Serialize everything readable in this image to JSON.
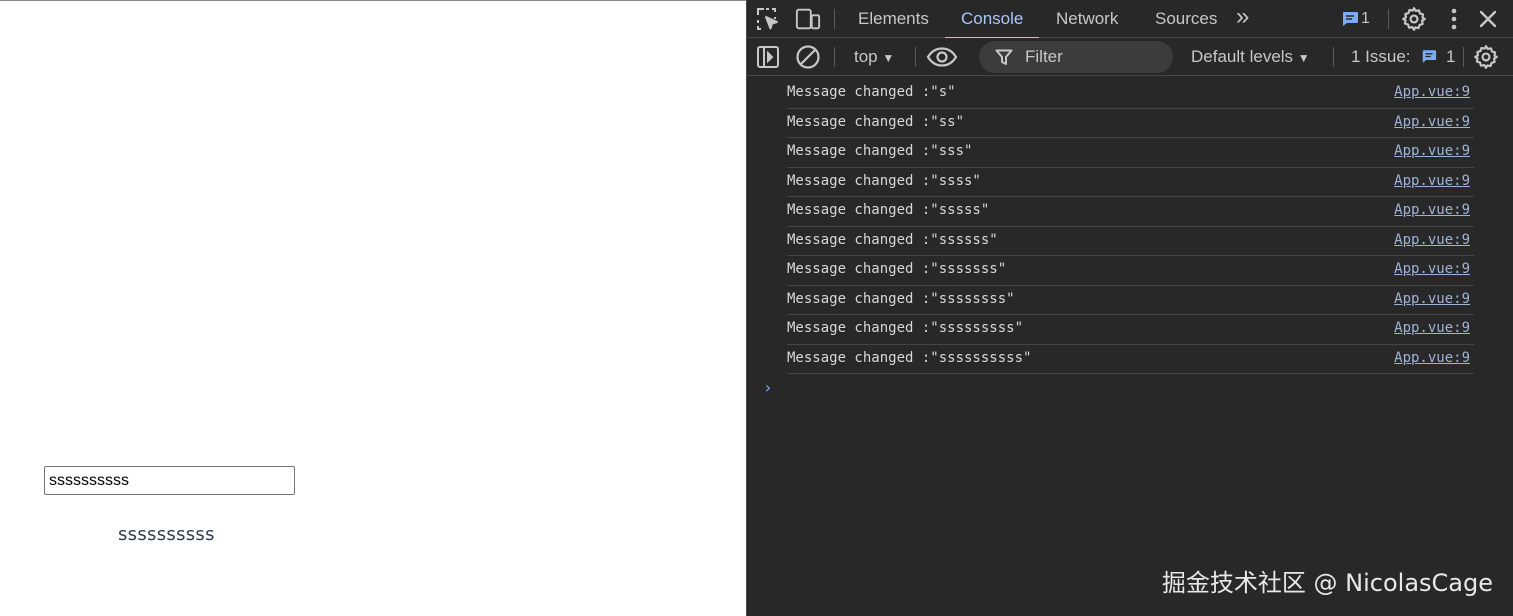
{
  "page": {
    "input_value": "ssssssssss",
    "echo_text": "ssssssssss"
  },
  "devtools": {
    "tabs": [
      {
        "label": "Elements",
        "active": false
      },
      {
        "label": "Console",
        "active": true
      },
      {
        "label": "Network",
        "active": false
      },
      {
        "label": "Sources",
        "active": false
      }
    ],
    "more_tabs_glyph": "»",
    "messages_badge": "1",
    "toolbar": {
      "context": "top",
      "filter_placeholder": "Filter",
      "levels": "Default levels",
      "issues_label": "1 Issue:",
      "issues_count": "1"
    },
    "console_messages": [
      {
        "text": "Message changed :\"s\"",
        "source": "App.vue:9"
      },
      {
        "text": "Message changed :\"ss\"",
        "source": "App.vue:9"
      },
      {
        "text": "Message changed :\"sss\"",
        "source": "App.vue:9"
      },
      {
        "text": "Message changed :\"ssss\"",
        "source": "App.vue:9"
      },
      {
        "text": "Message changed :\"sssss\"",
        "source": "App.vue:9"
      },
      {
        "text": "Message changed :\"ssssss\"",
        "source": "App.vue:9"
      },
      {
        "text": "Message changed :\"sssssss\"",
        "source": "App.vue:9"
      },
      {
        "text": "Message changed :\"ssssssss\"",
        "source": "App.vue:9"
      },
      {
        "text": "Message changed :\"sssssssss\"",
        "source": "App.vue:9"
      },
      {
        "text": "Message changed :\"ssssssssss\"",
        "source": "App.vue:9"
      }
    ],
    "prompt_glyph": "›"
  },
  "watermark": "掘金技术社区 @ NicolasCage",
  "colors": {
    "devtools_bg": "#282828",
    "accent": "#a8c7fa",
    "link": "#9fb3d9"
  }
}
